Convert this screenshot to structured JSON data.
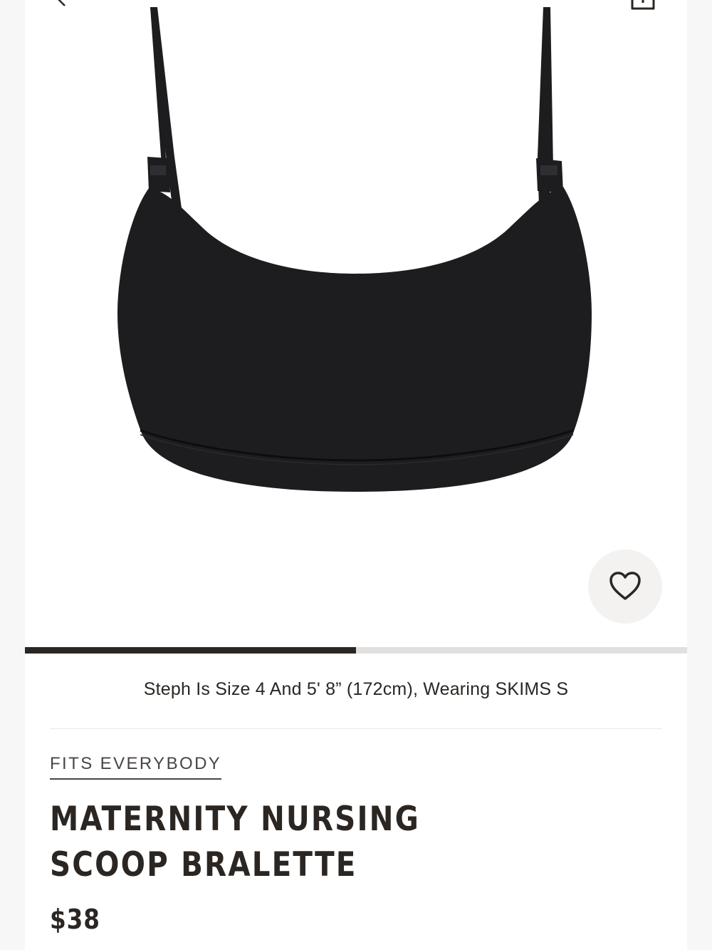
{
  "navigation": {
    "back_icon": "chevron-left-icon",
    "share_icon": "share-icon"
  },
  "product_image": {
    "description_icon": "product-photo",
    "colors": {
      "fabric": "#1d1d20",
      "background": "#ffffff"
    }
  },
  "wishlist": {
    "icon": "heart-outline-icon"
  },
  "gallery_progress": {
    "fraction": 0.5,
    "fill_color": "#2b2622",
    "track_color": "#e1e0de"
  },
  "model_info": "Steph Is Size 4 And 5' 8” (172cm), Wearing SKIMS S",
  "collection_label": "FITS EVERYBODY",
  "product": {
    "title": "MATERNITY NURSING SCOOP BRALETTE",
    "price": "$38"
  },
  "colors": {
    "text": "#2b2622",
    "page_bg": "#ffffff",
    "outer_bg": "#f7f7f7"
  }
}
